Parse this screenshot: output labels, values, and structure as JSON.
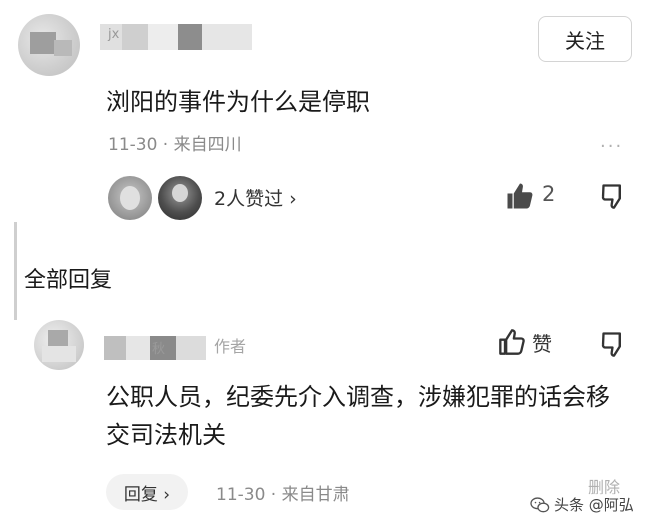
{
  "top_comment": {
    "username_fragment": "jx",
    "follow_label": "关注",
    "text": "浏阳的事件为什么是停职",
    "meta": "11-30 · 来自四川",
    "likers_text": "2人赞过 ›",
    "like_count": "2"
  },
  "section": {
    "title": "全部回复"
  },
  "reply": {
    "username_fragment": "秋",
    "author_badge": "作者",
    "like_label": "赞",
    "text": "公职人员，纪委先介入调查，涉嫌犯罪的话会移交司法机关",
    "reply_button_label": "回复 ›",
    "meta": "11-30 · 来自甘肃",
    "delete_label": "删除"
  },
  "watermark": {
    "text": "头条 @阿弘"
  },
  "colors": {
    "text_primary": "#1a1a1a",
    "text_secondary": "#8a8a8a",
    "border": "#d4d4d4"
  }
}
